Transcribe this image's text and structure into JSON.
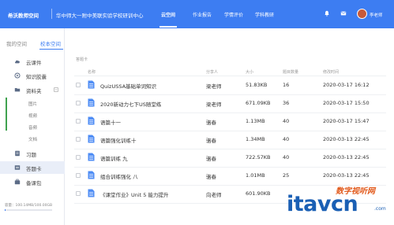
{
  "header": {
    "brand": "希沃教师空间",
    "school": "华中师大一附中美联实验学校研训中心",
    "nav": [
      "云空间",
      "作业报告",
      "学情评价",
      "学科教研"
    ],
    "active_nav": "云空间",
    "user_name": "李老师",
    "bell_icon": "bell-icon",
    "message_icon": "message-icon"
  },
  "sidebar": {
    "tabs": [
      "我的空间",
      "校本空间"
    ],
    "active_tab": "校本空间",
    "items": [
      {
        "label": "云课件",
        "icon": "cloud-icon"
      },
      {
        "label": "知识胶囊",
        "icon": "capsule-icon"
      },
      {
        "label": "资料夹",
        "icon": "folder-icon"
      },
      {
        "label": "习题",
        "icon": "exercise-icon"
      },
      {
        "label": "答题卡",
        "icon": "answer-card-icon"
      },
      {
        "label": "备课包",
        "icon": "package-icon"
      }
    ],
    "subitems": [
      "图片",
      "视频",
      "音频",
      "文档"
    ],
    "storage_text": "容量：100.14MB/100.00GB",
    "storage_fraction": 0.001
  },
  "main": {
    "breadcrumb": "答题卡",
    "columns": [
      "名称",
      "分享人",
      "大小",
      "题目数量",
      "修改时间"
    ],
    "rows": [
      {
        "name": "QuizUSSA基础单词知识",
        "sharer": "梁老师",
        "size": "51.83KB",
        "count": "16",
        "time": "2020-03-17 16:12"
      },
      {
        "name": "2020新动力七下US随堂练",
        "sharer": "梁老师",
        "size": "671.09KB",
        "count": "36",
        "time": "2020-03-17 15:50"
      },
      {
        "name": "语篇十一",
        "sharer": "骆春",
        "size": "1.13MB",
        "count": "40",
        "time": "2020-03-17 15:47"
      },
      {
        "name": "语篇强化训练十",
        "sharer": "骆春",
        "size": "1.34MB",
        "count": "40",
        "time": "2020-03-13 22:45"
      },
      {
        "name": "语篇训练 九",
        "sharer": "骆春",
        "size": "722.57KB",
        "count": "40",
        "time": "2020-03-13 22:45"
      },
      {
        "name": "组合训练强化 八",
        "sharer": "骆春",
        "size": "1.01MB",
        "count": "25",
        "time": "2020-03-13 22:45"
      },
      {
        "name": "《课堂作业》Unit 5 能力提升",
        "sharer": "向老师",
        "size": "601.90KB",
        "count": "",
        "time": ""
      }
    ]
  },
  "watermark": {
    "cn": "数字视听网",
    "en": "itavcn",
    "suffix": ".com"
  }
}
